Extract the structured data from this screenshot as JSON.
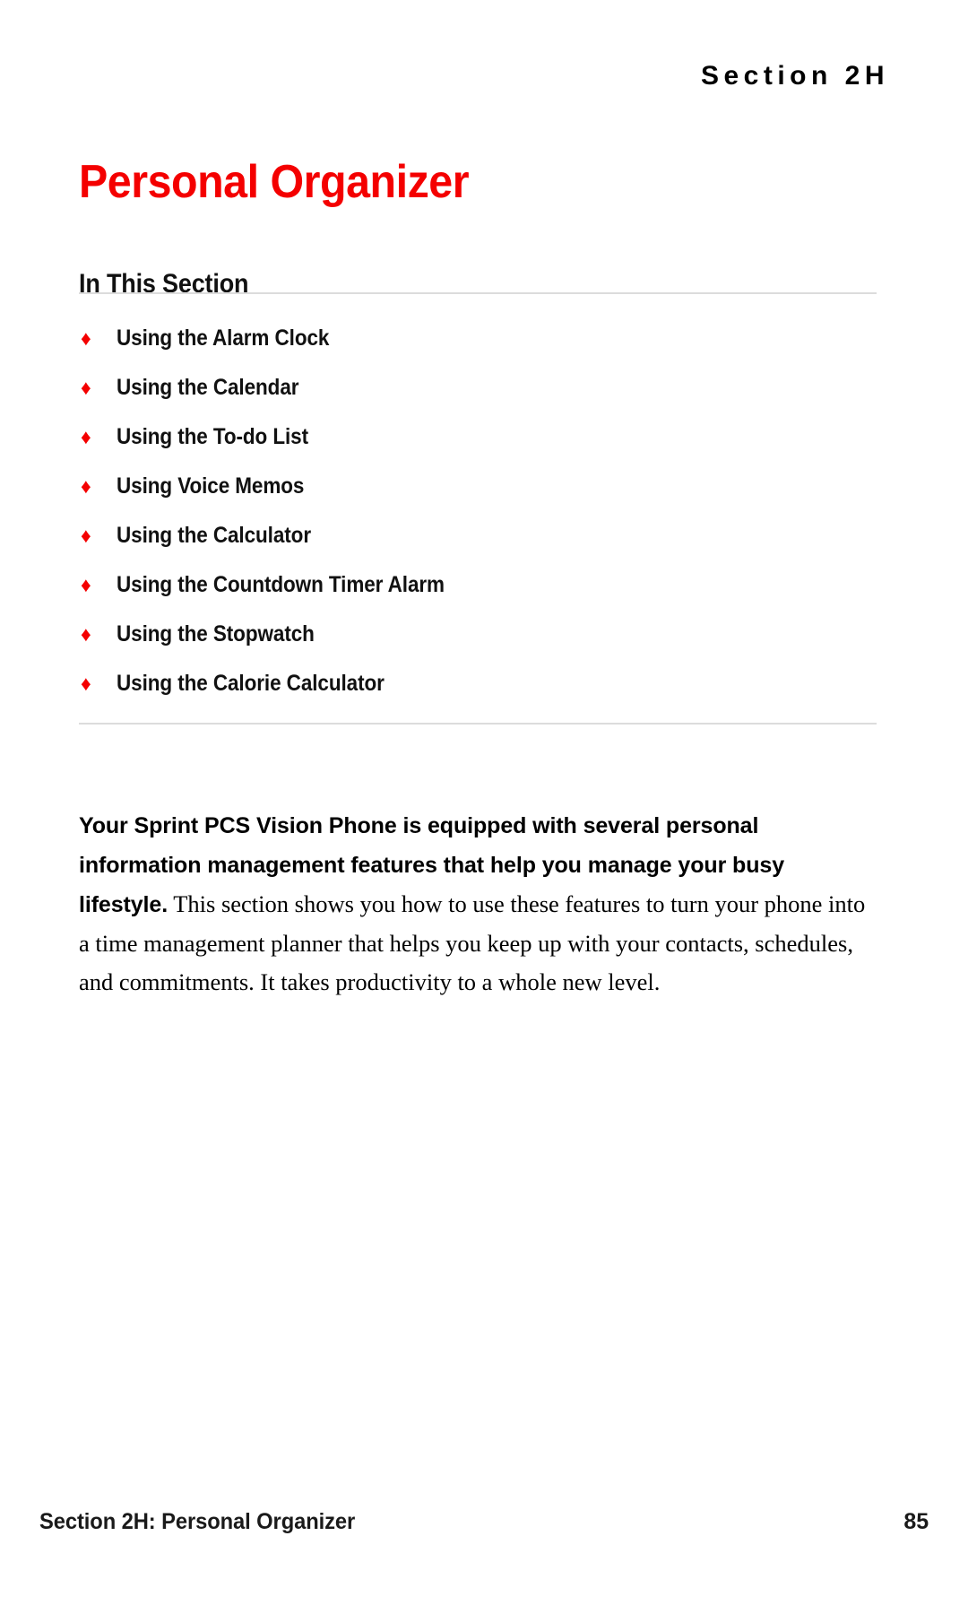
{
  "document": {
    "section_label": "Section 2H",
    "title": "Personal Organizer",
    "title_color": "#f40000",
    "bullet_color": "#f40000",
    "rule_color": "#dcdcdc",
    "page_background": "#ffffff"
  },
  "in_this_section": {
    "heading": "In This Section",
    "bullet_glyph": "♦",
    "items": [
      {
        "label": "Using the Alarm Clock"
      },
      {
        "label": "Using the Calendar"
      },
      {
        "label": "Using the To-do List"
      },
      {
        "label": "Using Voice Memos"
      },
      {
        "label": "Using the Calculator"
      },
      {
        "label": "Using the Countdown Timer Alarm"
      },
      {
        "label": "Using the Stopwatch"
      },
      {
        "label": "Using the Calorie Calculator"
      }
    ]
  },
  "intro": {
    "lead": "Your Sprint PCS Vision Phone is equipped with several personal information management features that help you manage your busy lifestyle.",
    "body": " This section shows you how to use these features to turn your phone into a time management planner that helps you keep up with your contacts, schedules, and commitments. It takes productivity to a whole new level."
  },
  "footer": {
    "left": "Section 2H: Personal Organizer",
    "page_number": "85"
  }
}
